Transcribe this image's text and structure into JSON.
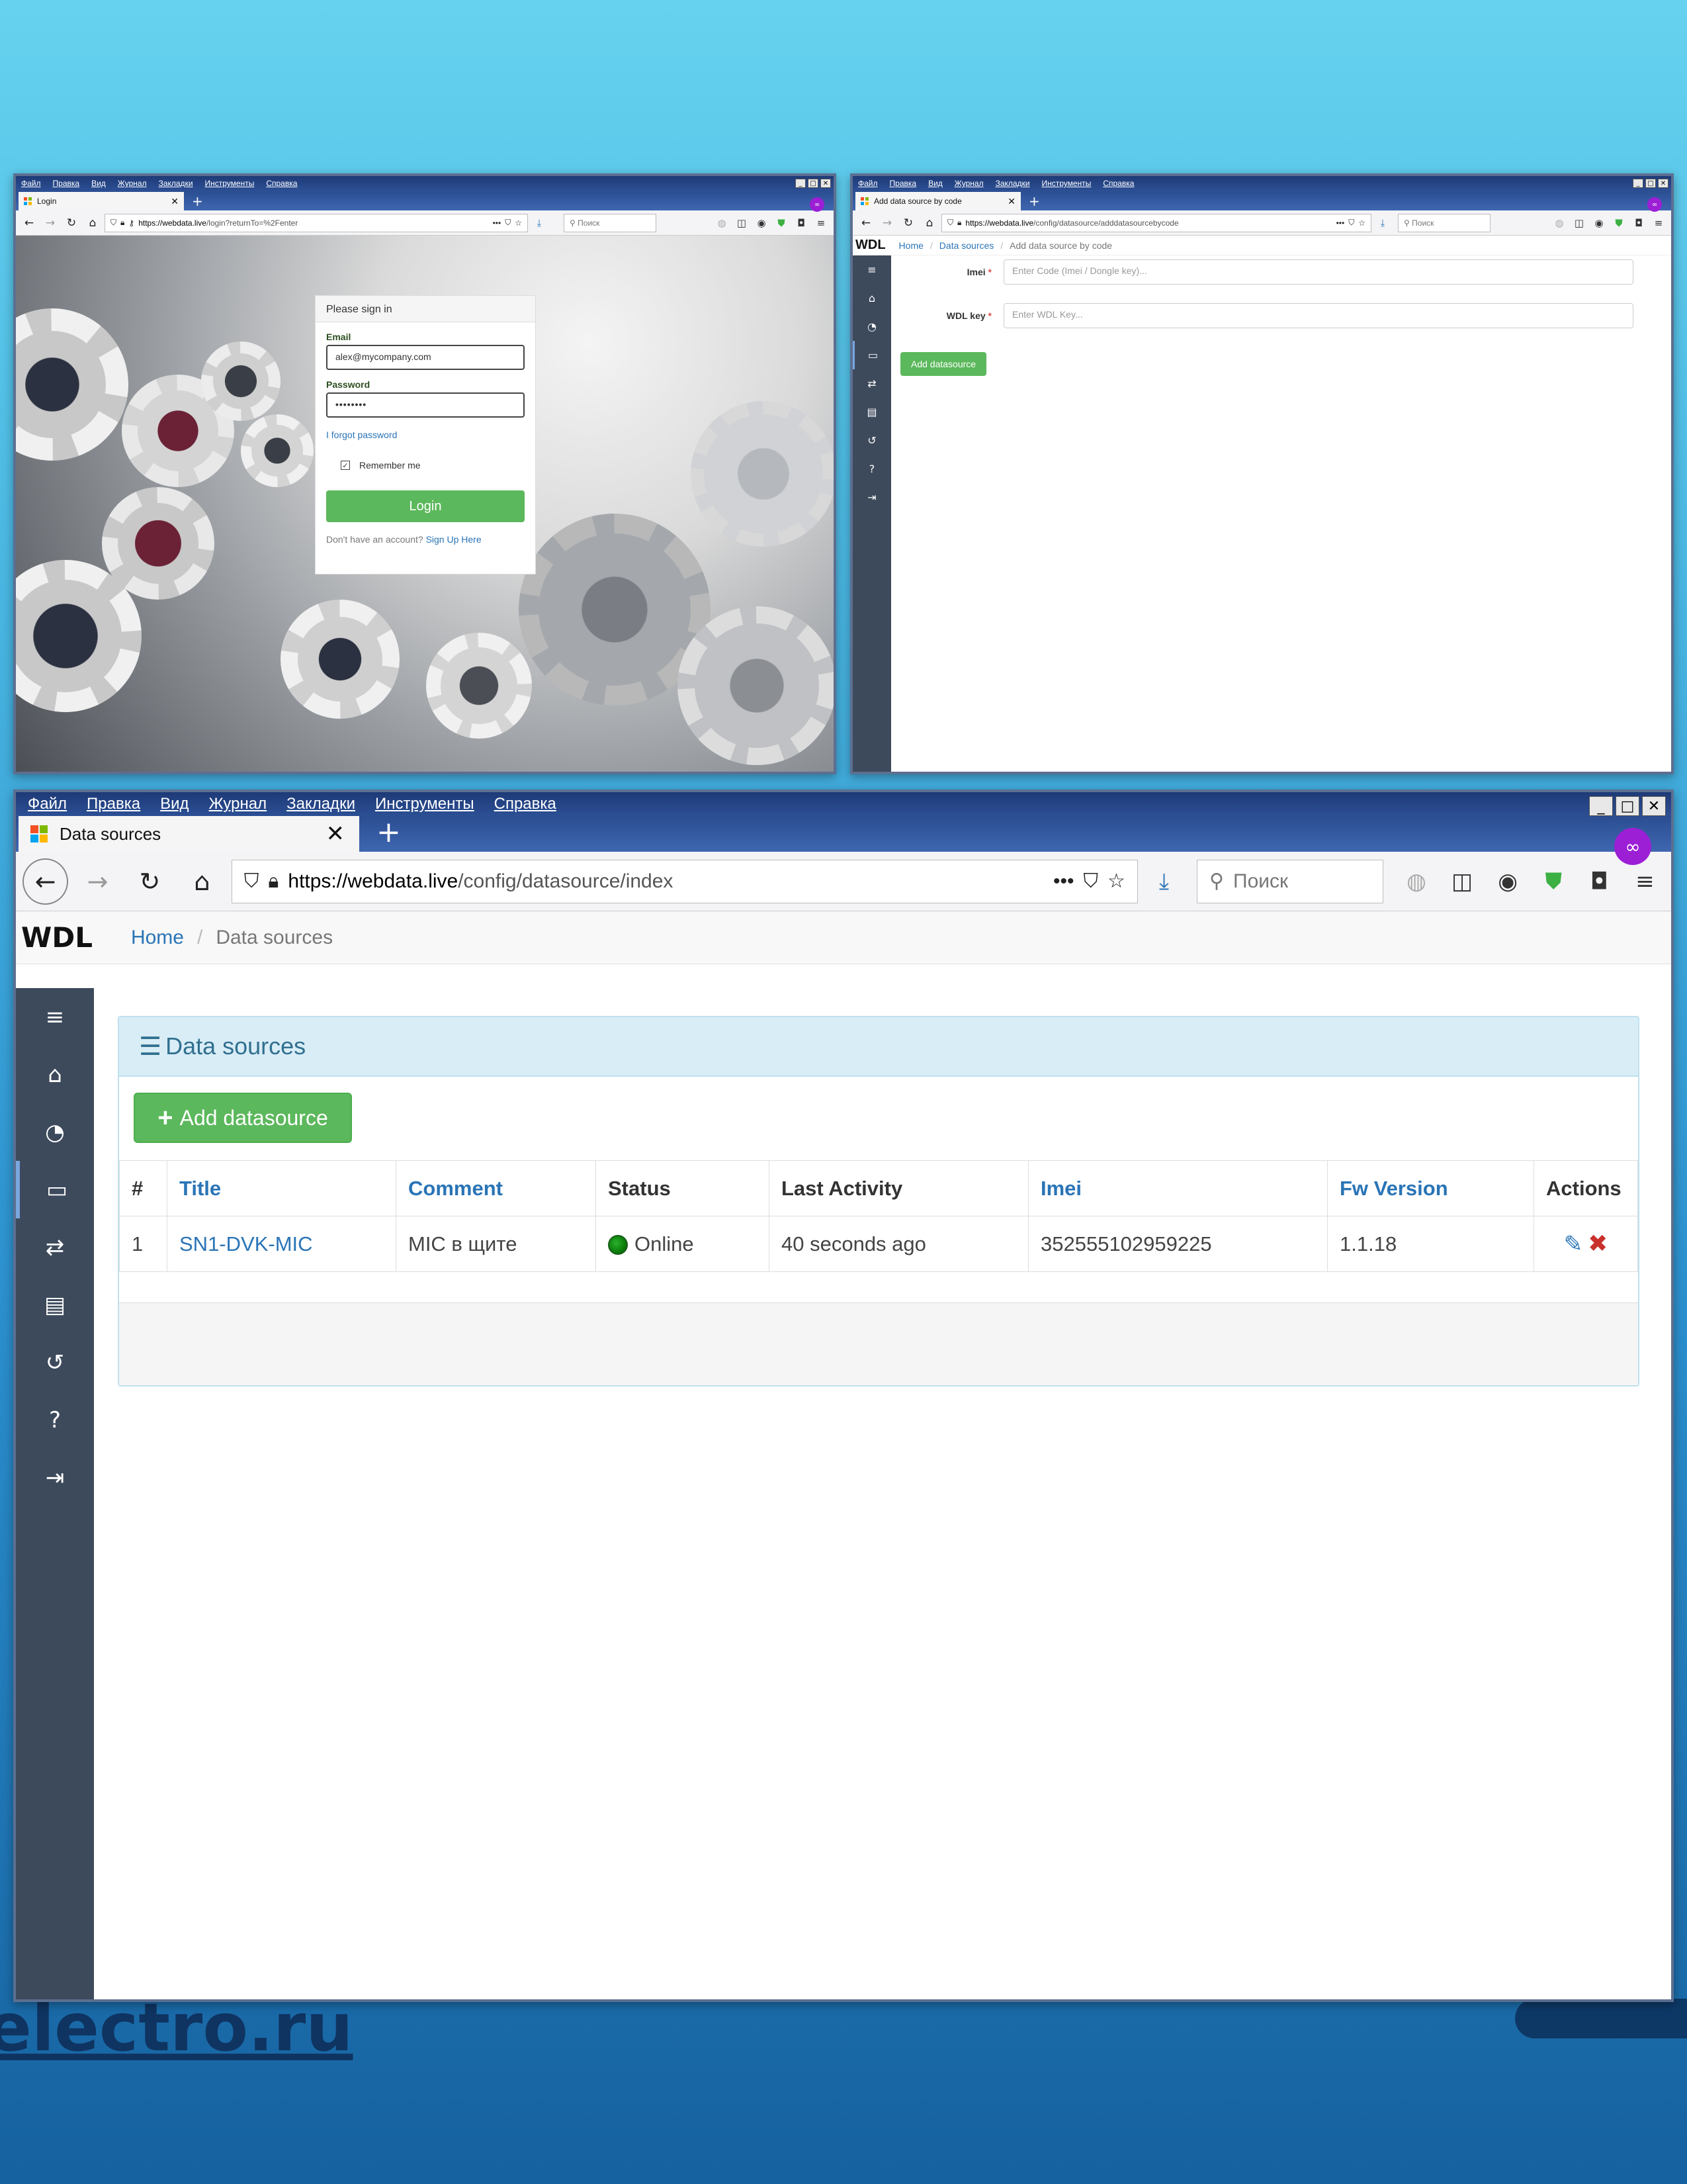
{
  "menu": [
    "Файл",
    "Правка",
    "Вид",
    "Журнал",
    "Закладки",
    "Инструменты",
    "Справка"
  ],
  "window_controls": {
    "minimize": "_",
    "maximize": "□",
    "close": "✕"
  },
  "new_tab": "+",
  "masked_icon": "∞",
  "search_placeholder": "Поиск",
  "login_window": {
    "tab_title": "Login",
    "url_host": "https://webdata.live",
    "url_path": "/login?returnTo=%2Fenter",
    "card": {
      "header": "Please sign in",
      "email_label": "Email",
      "email_value": "alex@mycompany.com",
      "password_label": "Password",
      "password_value": "••••••••",
      "forgot": "I forgot password",
      "remember": "Remember me",
      "remember_checked": true,
      "login_button": "Login",
      "footer_text": "Don't have an account?",
      "footer_link": "Sign Up Here"
    }
  },
  "addcode_window": {
    "tab_title": "Add data source by code",
    "url_host": "https://webdata.live",
    "url_path": "/config/datasource/adddatasourcebycode",
    "brand": "WDL",
    "breadcrumb": [
      "Home",
      "Data sources",
      "Add data source by code"
    ],
    "imei_label": "Imei",
    "imei_placeholder": "Enter Code (Imei / Dongle key)...",
    "wdl_key_label": "WDL key",
    "wdl_key_placeholder": "Enter WDL Key...",
    "required_mark": "*",
    "add_button": "Add datasource"
  },
  "datasources_window": {
    "tab_title": "Data sources",
    "url_host": "https://webdata.live",
    "url_path": "/config/datasource/index",
    "brand": "WDL",
    "breadcrumb": [
      "Home",
      "Data sources"
    ],
    "panel_title": "Data sources",
    "add_button": "Add datasource",
    "columns": [
      "#",
      "Title",
      "Comment",
      "Status",
      "Last Activity",
      "Imei",
      "Fw Version",
      "Actions"
    ],
    "rows": [
      {
        "num": "1",
        "title": "SN1-DVK-MIC",
        "comment": "MIC в щите",
        "status": "Online",
        "last_activity": "40 seconds ago",
        "imei": "352555102959225",
        "fw_version": "1.1.18"
      }
    ]
  },
  "sidebar_icons": [
    "menu-icon",
    "home-icon",
    "dashboard-icon",
    "datasource-icon",
    "exchange-icon",
    "report-icon",
    "history-icon",
    "help-icon",
    "logout-icon"
  ],
  "background_text": "electro.ru",
  "colors": {
    "accent_green": "#5cb85c",
    "link_blue": "#2a74b6",
    "sidebar": "#3d4a5c",
    "panel_header": "#d9edf7",
    "titlebar": "#1e3a77",
    "delete_red": "#c9302c"
  }
}
